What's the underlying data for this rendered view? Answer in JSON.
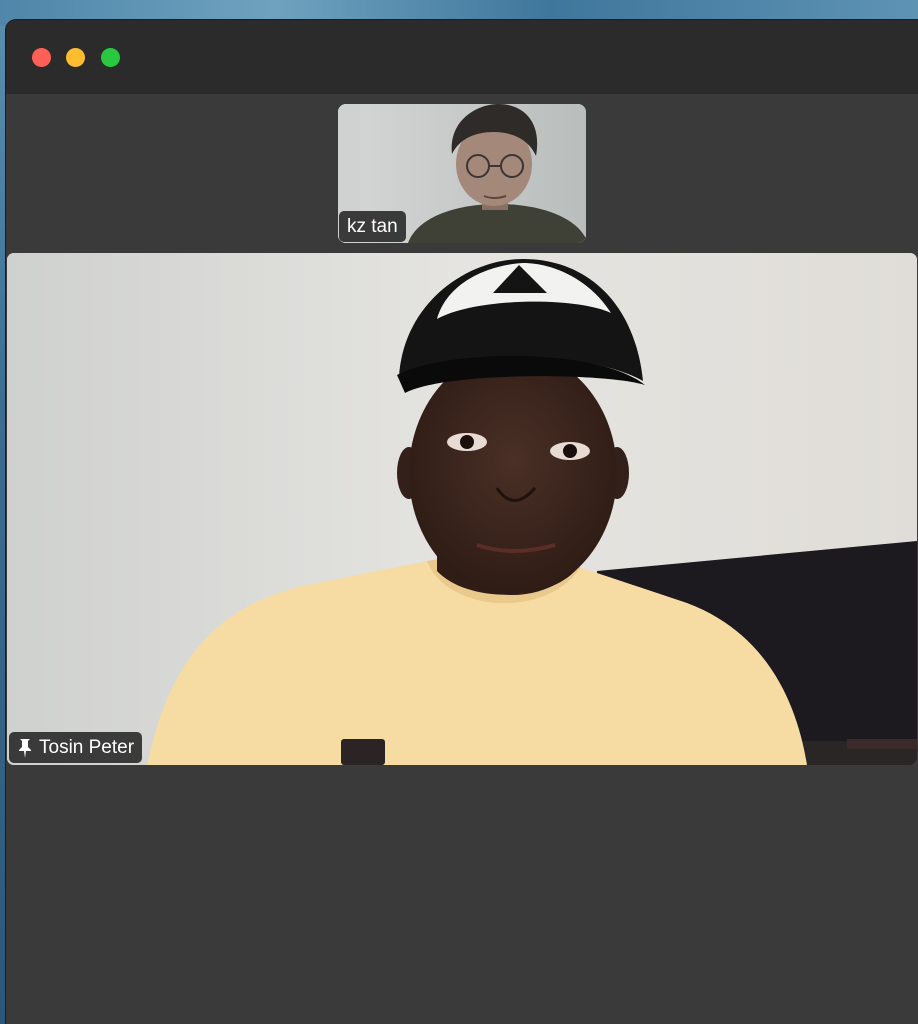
{
  "colors": {
    "window_bg": "#3a3a3a",
    "titlebar_bg": "#2b2b2b",
    "close": "#fe5f57",
    "minimize": "#febc2e",
    "maximize": "#28c840",
    "label_bg": "#191919",
    "label_text": "#ffffff"
  },
  "window": {
    "controls": [
      "close",
      "minimize",
      "maximize"
    ]
  },
  "participants": {
    "secondary": {
      "name": "kz tan",
      "video": "webcam-feed"
    },
    "primary": {
      "name": "Tosin Peter",
      "pinned": true,
      "pin_icon": "pin-icon",
      "video": "webcam-feed"
    }
  }
}
